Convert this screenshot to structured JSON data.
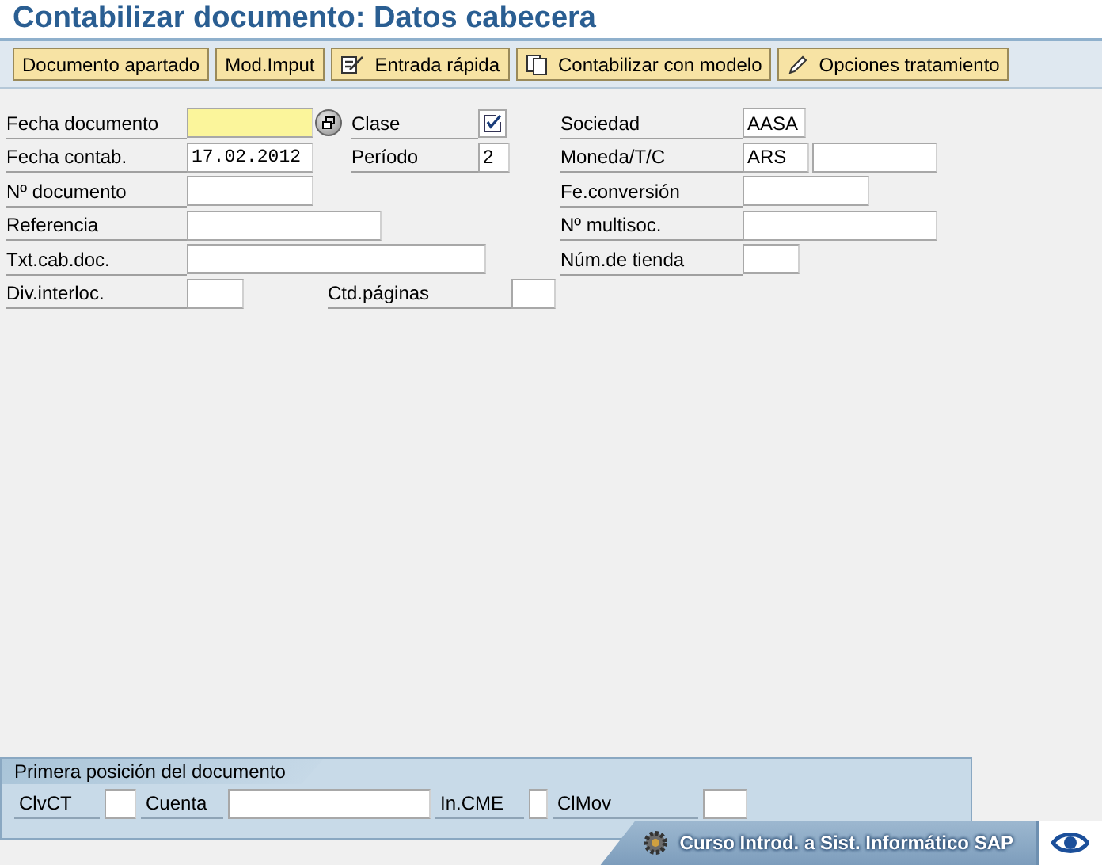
{
  "window": {
    "title": "Contabilizar documento: Datos cabecera"
  },
  "toolbar": [
    {
      "label": "Documento apartado"
    },
    {
      "label": "Mod.Imput"
    },
    {
      "label": "Entrada rápida"
    },
    {
      "label": "Contabilizar con modelo"
    },
    {
      "label": "Opciones tratamiento"
    }
  ],
  "header_fields": [
    {
      "label": "Fecha documento",
      "kind": "picker",
      "required": true
    },
    {
      "label": "Clase",
      "kind": "checkbox",
      "checked": true
    },
    {
      "label": "Sociedad",
      "kind": "text",
      "value": "AASA",
      "required": false
    },
    {
      "label": "Fecha contab.",
      "kind": "date",
      "value": "17.02.2012",
      "required": false
    },
    {
      "label": "Período",
      "kind": "text",
      "value": "2",
      "required": false
    },
    {
      "label": "Moneda/T/C",
      "kind": "pair",
      "value": "ARS",
      "required": false
    },
    {
      "label": "Nº documento",
      "kind": "text",
      "required": false
    },
    {
      "label": "Fe.conversión",
      "kind": "text",
      "required": false
    },
    {
      "label": "Referencia",
      "kind": "text",
      "required": false
    },
    {
      "label": "Nº multisoc.",
      "kind": "text",
      "required": false
    },
    {
      "label": "Txt.cab.doc.",
      "kind": "text",
      "required": false
    },
    {
      "label": "Núm.de tienda",
      "kind": "text",
      "required": false
    },
    {
      "label": "Div.interloc.",
      "kind": "text",
      "required": false
    },
    {
      "label": "Ctd.páginas",
      "kind": "text",
      "required": false
    }
  ],
  "first_item_panel": {
    "title": "Primera posición del documento",
    "fields": [
      {
        "label": "ClvCT"
      },
      {
        "label": "Cuenta"
      },
      {
        "label": "In.CME"
      },
      {
        "label": "ClMov"
      }
    ]
  },
  "status_bar": {
    "text": "Curso Introd. a Sist. Informático SAP"
  }
}
